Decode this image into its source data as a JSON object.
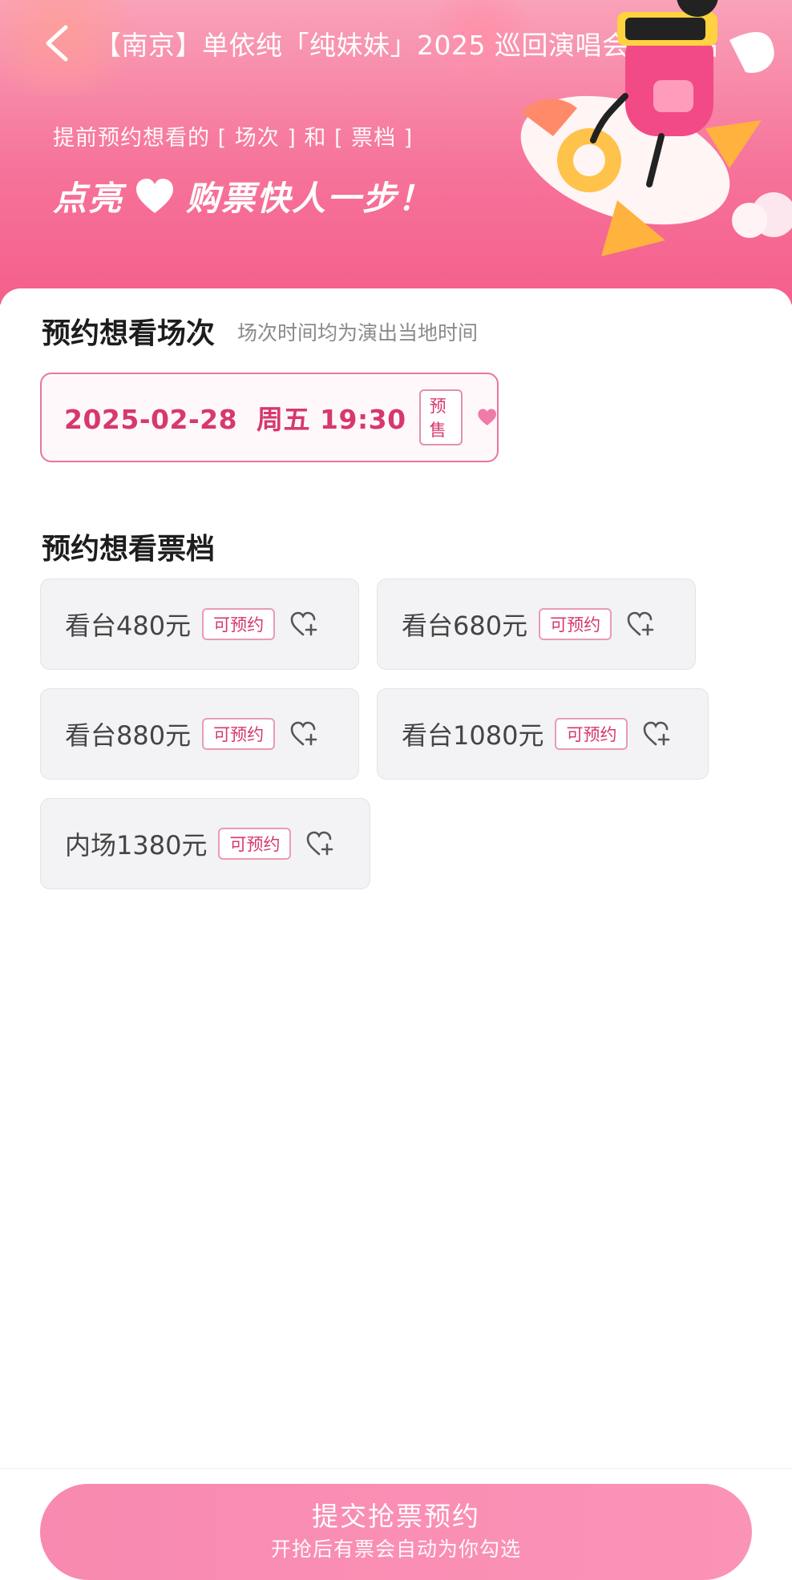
{
  "header": {
    "back_icon": "chevron-left-icon",
    "title": "【南京】单依纯「纯妹妹」2025 巡回演唱会 南京站",
    "promo_line1": "提前预约想看的 [ 场次 ] 和 [ 票档 ]",
    "promo_line2_left": "点亮",
    "promo_line2_right": "购票快人一步！",
    "colors": {
      "gradient_top": "#f9a2b8",
      "gradient_bottom": "#f45f8b"
    }
  },
  "sessions": {
    "title": "预约想看场次",
    "subtitle": "场次时间均为演出当地时间",
    "items": [
      {
        "date": "2025-02-28  周五 19:30",
        "tag": "预售",
        "selected": true
      }
    ]
  },
  "tiers": {
    "title": "预约想看票档",
    "items": [
      {
        "label": "看台480元",
        "tag": "可预约"
      },
      {
        "label": "看台680元",
        "tag": "可预约"
      },
      {
        "label": "看台880元",
        "tag": "可预约"
      },
      {
        "label": "看台1080元",
        "tag": "可预约"
      },
      {
        "label": "内场1380元",
        "tag": "可预约"
      }
    ]
  },
  "footer": {
    "submit_label": "提交抢票预约",
    "submit_sub": "开抢后有票会自动为你勾选"
  },
  "accent_color": "#d6386f"
}
